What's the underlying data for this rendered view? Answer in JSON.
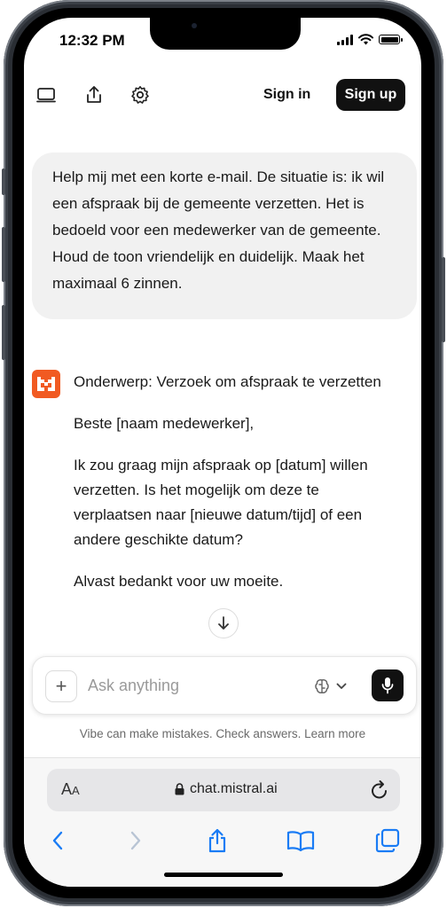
{
  "status_bar": {
    "time": "12:32 PM"
  },
  "header": {
    "sign_in": "Sign in",
    "sign_up": "Sign up",
    "icons": [
      "sidebar-icon",
      "share-icon",
      "settings-icon"
    ]
  },
  "chat": {
    "user_message": "Help mij met een korte e-mail. De situatie is: ik wil een afspraak bij de gemeente verzetten. Het is bedoeld voor een medewerker van de gemeente. Houd de toon vriendelijk en duidelijk. Maak het maximaal 6 zinnen.",
    "assistant_paragraphs": [
      "Onderwerp: Verzoek om afspraak te verzetten",
      "Beste [naam medewerker],",
      "Ik zou graag mijn afspraak op [datum] willen verzetten. Is het mogelijk om deze te verplaatsen naar [nieuwe datum/tijd] of een andere geschikte datum?",
      "Alvast bedankt voor uw moeite."
    ],
    "avatar_color": "#f15a22"
  },
  "composer": {
    "placeholder": "Ask anything",
    "plus": "+"
  },
  "disclaimer": "Vibe can make mistakes. Check answers. Learn more",
  "browser": {
    "aa_label_big": "A",
    "aa_label_small": "A",
    "url": "chat.mistral.ai",
    "accent": "#1a7cf5"
  }
}
